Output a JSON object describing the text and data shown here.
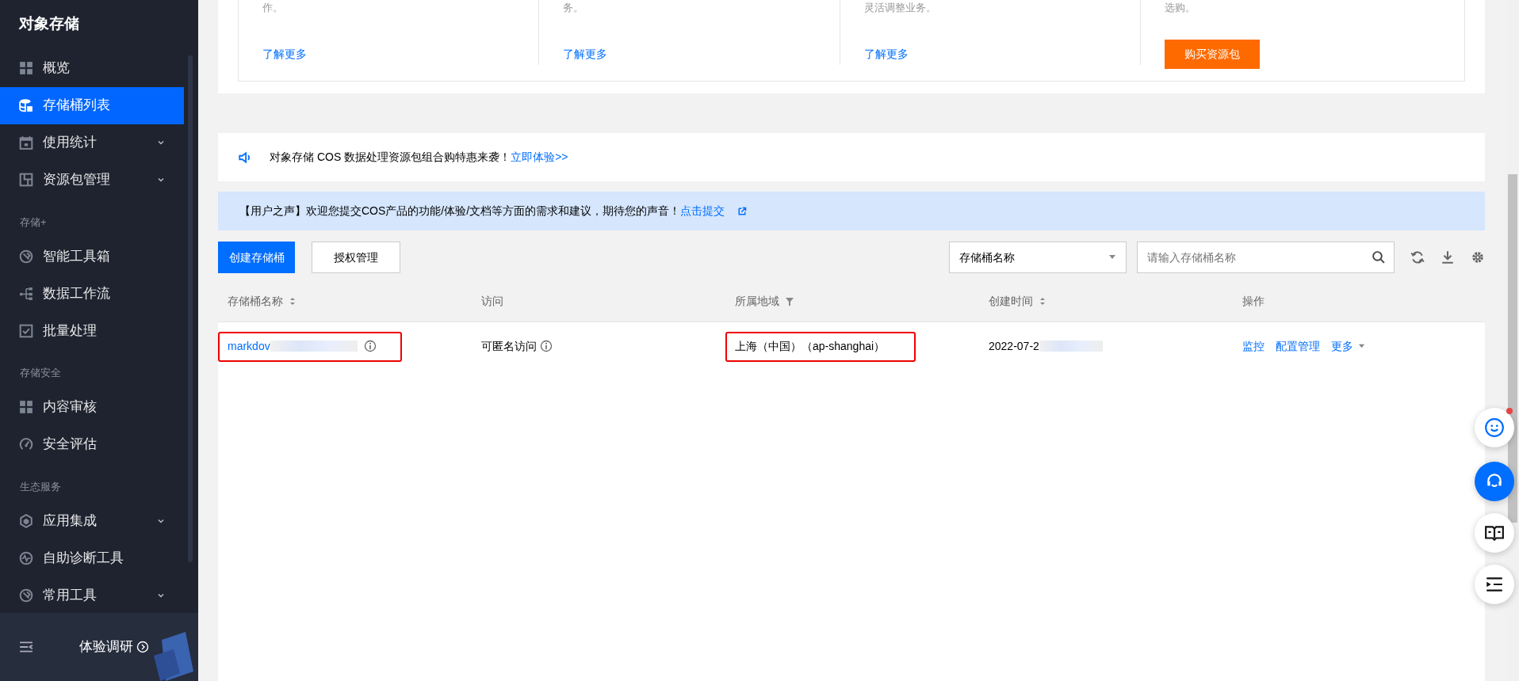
{
  "sidebar": {
    "title": "对象存储",
    "sections": [
      {
        "items": [
          {
            "label": "概览",
            "selected": false,
            "has_submenu": false
          },
          {
            "label": "存储桶列表",
            "selected": true,
            "has_submenu": false
          },
          {
            "label": "使用统计",
            "selected": false,
            "has_submenu": true
          },
          {
            "label": "资源包管理",
            "selected": false,
            "has_submenu": true
          }
        ]
      },
      {
        "label": "存储+",
        "items": [
          {
            "label": "智能工具箱",
            "selected": false,
            "has_submenu": false
          },
          {
            "label": "数据工作流",
            "selected": false,
            "has_submenu": false
          },
          {
            "label": "批量处理",
            "selected": false,
            "has_submenu": false
          }
        ]
      },
      {
        "label": "存储安全",
        "items": [
          {
            "label": "内容审核",
            "selected": false,
            "has_submenu": false
          },
          {
            "label": "安全评估",
            "selected": false,
            "has_submenu": false
          }
        ]
      },
      {
        "label": "生态服务",
        "items": [
          {
            "label": "应用集成",
            "selected": false,
            "has_submenu": true
          },
          {
            "label": "自助诊断工具",
            "selected": false,
            "has_submenu": false
          },
          {
            "label": "常用工具",
            "selected": false,
            "has_submenu": true
          }
        ]
      }
    ],
    "survey": "体验调研"
  },
  "promo_cards": [
    {
      "text": "作。",
      "link": "了解更多"
    },
    {
      "text": "务。",
      "link": "了解更多"
    },
    {
      "text": "灵活调整业务。",
      "link": "了解更多"
    },
    {
      "text": "选购。",
      "button": "购买资源包"
    }
  ],
  "announcement": {
    "text": "对象存储 COS 数据处理资源包组合购特惠来袭！",
    "link": "立即体验>>"
  },
  "feedback": {
    "text": "【用户之声】欢迎您提交COS产品的功能/体验/文档等方面的需求和建议，期待您的声音！",
    "link": "点击提交"
  },
  "toolbar": {
    "buttons": [
      "创建存储桶",
      "授权管理"
    ],
    "filter_select": "存储桶名称",
    "search": {
      "placeholder": "请输入存储桶名称"
    }
  },
  "table": {
    "columns": [
      {
        "label": "存储桶名称",
        "sortable": true,
        "filterable": false
      },
      {
        "label": "访问",
        "sortable": false,
        "filterable": false
      },
      {
        "label": "所属地域",
        "sortable": false,
        "filterable": true
      },
      {
        "label": "创建时间",
        "sortable": true,
        "filterable": false
      },
      {
        "label": "操作",
        "sortable": false,
        "filterable": false
      }
    ],
    "rows": [
      {
        "name": {
          "text": "markdov",
          "redacted": true,
          "highlighted": true
        },
        "access": {
          "text": "可匿名访问"
        },
        "region": {
          "text": "上海（中国）（ap-shanghai）",
          "highlighted": true
        },
        "created": {
          "text": "2022-07-2",
          "redacted": true
        },
        "actions": [
          {
            "label": "监控",
            "dropdown": false
          },
          {
            "label": "配置管理",
            "dropdown": false
          },
          {
            "label": "更多",
            "dropdown": true
          }
        ]
      }
    ]
  },
  "floating_buttons": [
    {
      "notification": true,
      "selected": false
    },
    {
      "notification": false,
      "selected": true
    },
    {
      "notification": false,
      "selected": false
    },
    {
      "notification": false,
      "selected": false
    }
  ]
}
